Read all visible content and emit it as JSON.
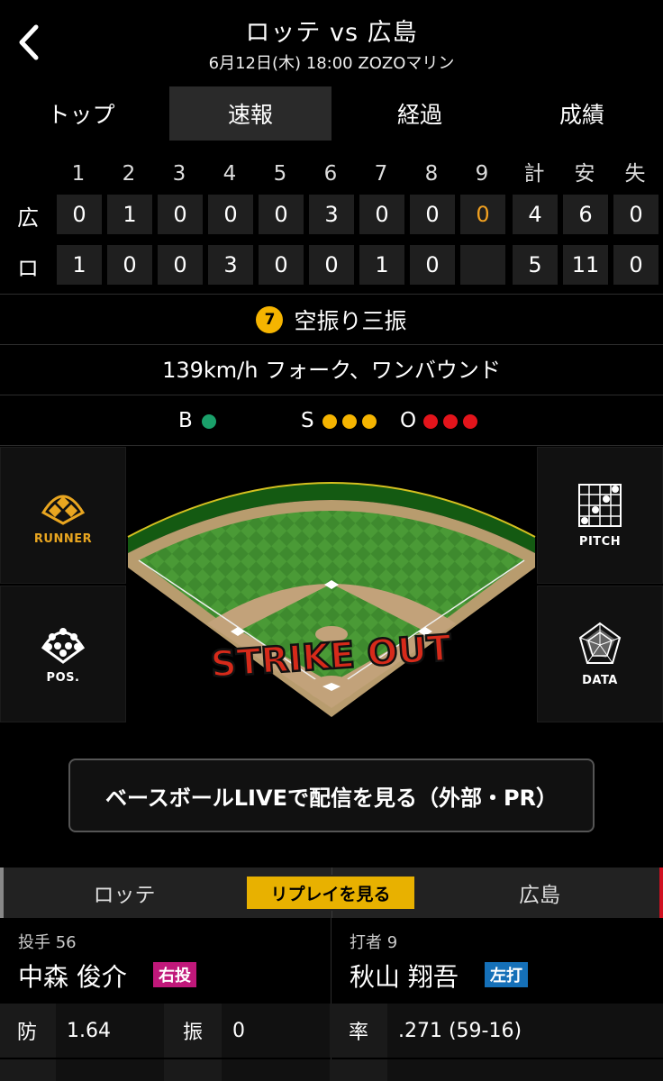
{
  "header": {
    "title": "ロッテ vs 広島",
    "subtitle": "6月12日(木) 18:00 ZOZOマリン"
  },
  "tabs": [
    {
      "label": "トップ",
      "active": false
    },
    {
      "label": "速報",
      "active": true
    },
    {
      "label": "経過",
      "active": false
    },
    {
      "label": "成績",
      "active": false
    }
  ],
  "scoreboard": {
    "headers": [
      "1",
      "2",
      "3",
      "4",
      "5",
      "6",
      "7",
      "8",
      "9",
      "計",
      "安",
      "失"
    ],
    "rows": [
      {
        "team": "広",
        "cells": [
          "0",
          "1",
          "0",
          "0",
          "0",
          "3",
          "0",
          "0",
          "0",
          "4",
          "6",
          "0"
        ]
      },
      {
        "team": "ロ",
        "cells": [
          "1",
          "0",
          "0",
          "3",
          "0",
          "0",
          "1",
          "0",
          "",
          "5",
          "11",
          "0"
        ]
      }
    ],
    "highlight_color": "#f0a020"
  },
  "play": {
    "number": "7",
    "result": "空振り三振",
    "pitch": "139km/h フォーク、ワンバウンド"
  },
  "count": {
    "b_label": "B",
    "balls": 1,
    "ball_color": "#1aa06a",
    "s_label": "S",
    "strikes": 3,
    "strike_color": "#f5b400",
    "o_label": "O",
    "outs": 3,
    "out_color": "#e3141b"
  },
  "field_buttons": {
    "runner": "RUNNER",
    "pitch": "PITCH",
    "pos": "POS.",
    "data": "DATA"
  },
  "field_overlay": "STRIKE OUT",
  "live_button": "ベースボールLIVEで配信を見る（外部・PR）",
  "bottom_tabs": {
    "left": "ロッテ",
    "replay": "リプレイを見る",
    "right": "広島"
  },
  "pitcher": {
    "role": "投手 56",
    "name": "中森 俊介",
    "badge": "右投",
    "badge_color": "#c0187a",
    "stats": [
      {
        "label": "防",
        "value": "1.64"
      },
      {
        "label": "振",
        "value": "0"
      }
    ]
  },
  "batter": {
    "role": "打者 9",
    "name": "秋山 翔吾",
    "badge": "左打",
    "badge_color": "#1570b8",
    "stats": [
      {
        "label": "率",
        "value": ".271 (59-16)"
      }
    ]
  }
}
